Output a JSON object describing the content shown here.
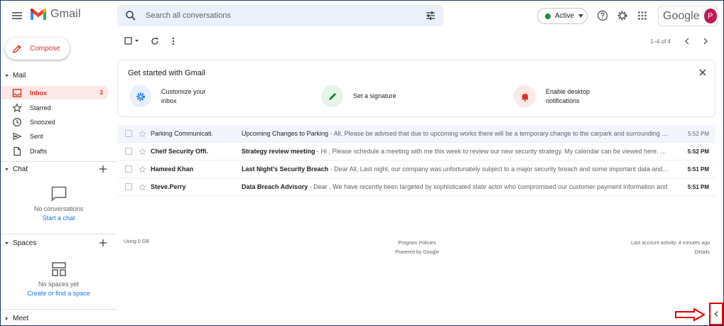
{
  "app": {
    "name": "Gmail"
  },
  "search": {
    "placeholder": "Search all conversations"
  },
  "status": {
    "label": "Active"
  },
  "account": {
    "brand": "Google",
    "avatar_letter": "P"
  },
  "compose": {
    "label": "Compose"
  },
  "sections": {
    "mail": "Mail",
    "chat": "Chat",
    "spaces": "Spaces",
    "meet": "Meet"
  },
  "nav": [
    {
      "label": "Inbox",
      "count": "3"
    },
    {
      "label": "Starred"
    },
    {
      "label": "Snoozed"
    },
    {
      "label": "Sent"
    },
    {
      "label": "Drafts"
    }
  ],
  "chat": {
    "empty": "No conversations",
    "link": "Start a chat"
  },
  "spaces": {
    "empty": "No spaces yet",
    "link": "Create or find a space"
  },
  "pager": {
    "text": "1–4 of 4"
  },
  "get_started": {
    "title": "Get started with Gmail",
    "items": [
      {
        "label": "Customize your inbox"
      },
      {
        "label": "Set a signature"
      },
      {
        "label": "Enable desktop notifications"
      }
    ]
  },
  "emails": [
    {
      "sender": "Parking Communicati.",
      "subject": "Upcoming Changes to Parking",
      "snippet": " - All, Please be advised that due to upcoming works there will be a temporary change to the carpark and surrounding area",
      "time": "5:52 PM",
      "unread": false
    },
    {
      "sender": "Cheif Security Offi.",
      "subject": "Strategy review meeting",
      "snippet": " - Hi , Please schedule a meeting with me this week to review our new security strategy. My calendar can be viewed here. Thanks",
      "time": "5:52 PM",
      "unread": true
    },
    {
      "sender": "Hameed Khan",
      "subject": "Last Night's Security Breach",
      "snippet": " - Dear All, Last night, our company was unfortunately subject to a major security breach and some important data and files",
      "time": "5:51 PM",
      "unread": true
    },
    {
      "sender": "Steve.Perry",
      "subject": "Data Breach Advisory",
      "snippet": " - Dear , We have recently been targeted by sophisticated state actor who compromised our customer payment information and",
      "time": "5:51 PM",
      "unread": true
    }
  ],
  "footer": {
    "storage": "Using 0 GB",
    "policies": "Program Policies",
    "powered": "Powered by Google",
    "activity": "Last account activity: 4 minutes ago",
    "details": "Details"
  },
  "colors": {
    "accent": "#d93025",
    "link": "#1a73e8",
    "active": "#1e8e3e",
    "annotation": "#e00000"
  }
}
